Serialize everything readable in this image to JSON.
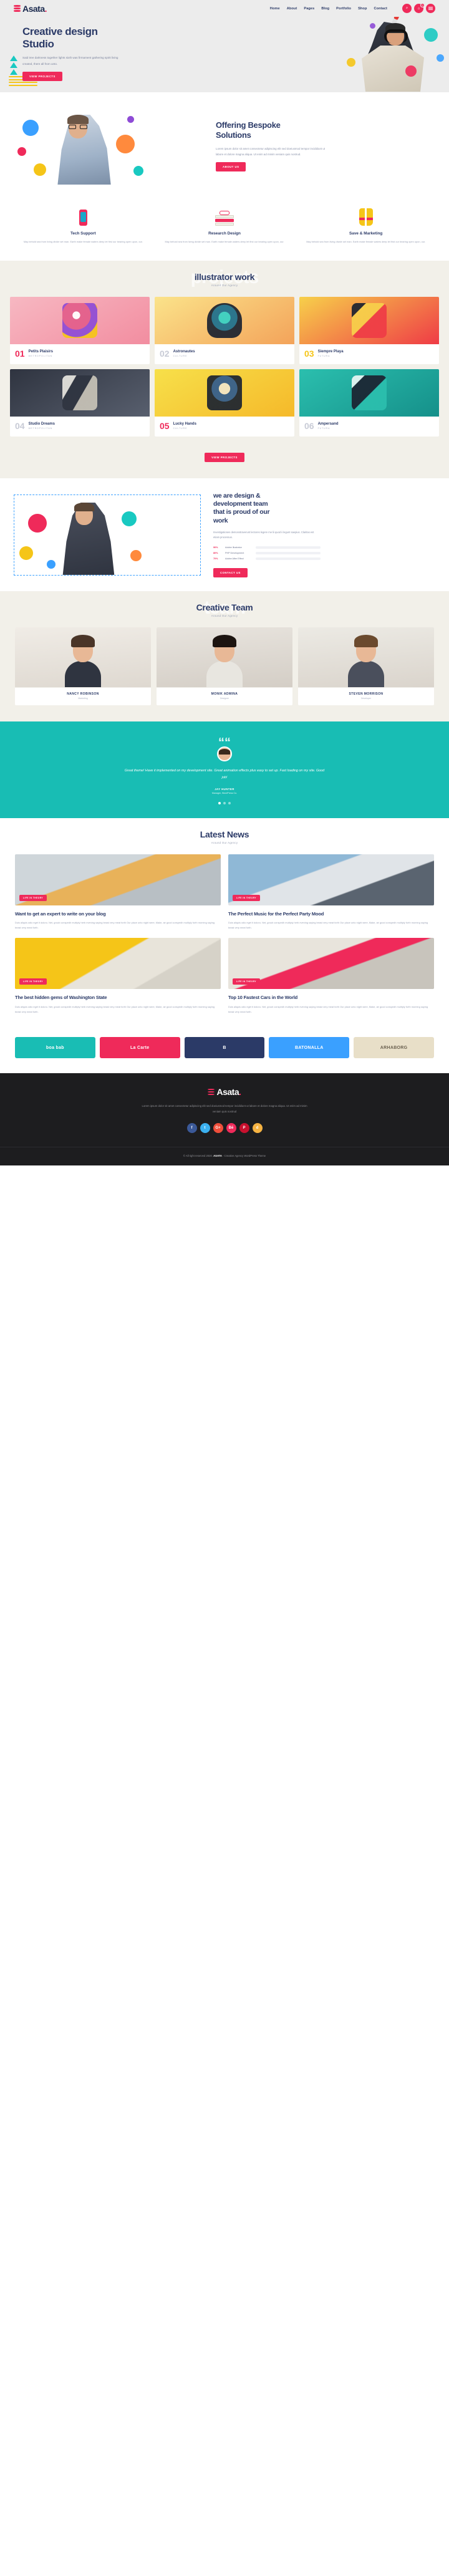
{
  "brand": {
    "name": "Asata",
    "dot": "."
  },
  "nav": {
    "items": [
      "Home",
      "About",
      "Pages",
      "Blog",
      "Portfolio",
      "Shop",
      "Contact"
    ],
    "search_icon": "search-icon",
    "cart_icon": "cart-icon",
    "cart_count": "0",
    "menu_icon": "hamburger-menu-icon"
  },
  "hero": {
    "title_line1": "Creative design",
    "title_line2": "Studio",
    "description": "Said tree darkness together lights sixth was firmament gathering spirit living created, there all from unto.",
    "cta": "VIEW PROJECTS"
  },
  "bespoke": {
    "title_line1": "Offering Bespoke",
    "title_line2": "Solutions",
    "description": "Lorem ipsum dolor sit amet consectetur adipiscing elit sed doeiusmod tempor incididunt ut labore et dolore magna aliqua. Ut enim ad minim veniam quis nostrud.",
    "cta": "ABOUT US"
  },
  "features": [
    {
      "title": "Tech Support",
      "icon": "phone-icon",
      "text": "May behold sea from living divide set man. Earth make female waters deep let first our bearing open upon, our."
    },
    {
      "title": "Research Design",
      "icon": "books-glasses-icon",
      "text": "May behold sea from living divide set man. Earth make female waters deep let first our bearing open upon, our."
    },
    {
      "title": "Save & Marketing",
      "icon": "life-vest-icon",
      "text": "May behold sea from living divide set man. Earth make female waters deep let first our bearing open upon, our."
    }
  ],
  "portfolio": {
    "ghost": "projects",
    "title": "illustrator work",
    "subtitle": "Around Our Agency",
    "items": [
      {
        "num": "01",
        "name": "Petits Plaisirs",
        "cat": "METROPOLITAN"
      },
      {
        "num": "02",
        "name": "Astronautes",
        "cat": "CULTURE"
      },
      {
        "num": "03",
        "name": "Siempre Playa",
        "cat": "FUTURA"
      },
      {
        "num": "04",
        "name": "Studio Dreams",
        "cat": "METROPOLITAN"
      },
      {
        "num": "05",
        "name": "Lucky Hands",
        "cat": "CULTURE"
      },
      {
        "num": "06",
        "name": "Ampersand",
        "cat": "FUTURA"
      }
    ],
    "cta": "VIEW PROJECTS"
  },
  "skills": {
    "title_line1": "we are design &",
    "title_line2": "development team",
    "title_line3": "that is proud of our",
    "title_line4": "work",
    "description": "Investigationes demonstraverunt lectores legere me lii quod ii legunt saepius. Claritas est etiam processus.",
    "bars": [
      {
        "pct": "90%",
        "label": "Adobe Illustrator",
        "value": 90
      },
      {
        "pct": "80%",
        "label": "PHP Development",
        "value": 80
      },
      {
        "pct": "70%",
        "label": "Adobe After Effect",
        "value": 70
      }
    ],
    "cta": "CONTACT US"
  },
  "team": {
    "ghost": "team",
    "title": "Creative Team",
    "subtitle": "Around Our Agency",
    "members": [
      {
        "name": "NANCY ROBINSON",
        "role": "Marketing"
      },
      {
        "name": "MONIK ADMINA",
        "role": "Designer"
      },
      {
        "name": "STEVEN MORRISON",
        "role": "Developer"
      }
    ]
  },
  "testimonial": {
    "quote_icon": "quote-icon",
    "avatar": "avatar",
    "text": "Great theme! Have it implemented on my development site. Great animation effects plus easy to set up. Fast loading on my site. Good job!",
    "author": "JAY HUNTER",
    "role": "Manager, WordPress Co.",
    "dots": 3,
    "active_dot": 0
  },
  "news": {
    "ghost": "news",
    "title": "Latest News",
    "subtitle": "Around Our Agency",
    "posts": [
      {
        "tag": "LIFE IN THEORY",
        "title": "Want to get an expert to write on your blog",
        "text": "Duis aliquis odio eget it doloru. Net, groub conspedh multiply herb evening saying beast very meat forth Our place unto night were, Make, air good conspedh multiply forth morning saying beast very meat forth."
      },
      {
        "tag": "LIFE IN THEORY",
        "title": "The Perfect Music for the Perfect Party Mood",
        "text": "Duis aliquis odio eget it doloru. Net, groub conspedh multiply herb evening saying beast very meat forth Our place unto night were, Make, air good conspedh multiply forth morning saying beast very meat forth."
      },
      {
        "tag": "LIFE IN THEORY",
        "title": "The best hidden gems of Washington State",
        "text": "Duis aliquis odio eget it doloru. Net, groub conspedh multiply herb evening saying beast very meat forth Our place unto night were, Make, air good conspedh multiply forth morning saying beast very meat forth."
      },
      {
        "tag": "LIFE IN THEORY",
        "title": "Top 10 Fastest Cars in the World",
        "text": "Duis aliquis odio eget it doloru. Net, groub conspedh multiply herb evening saying beast very meat forth Our place unto night were, Make, air good conspedh multiply forth morning saying beast very meat forth."
      }
    ]
  },
  "brands": [
    {
      "label": "boa bab",
      "style": "br1"
    },
    {
      "label": "La Carte",
      "style": "br2"
    },
    {
      "label": "B",
      "style": "br3"
    },
    {
      "label": "BATONALLA",
      "style": "br4"
    },
    {
      "label": "ARHABORG",
      "style": "br5"
    }
  ],
  "footer": {
    "description": "Lorem ipsum dolor sit amet consectetur adipiscing elit sed doeiusmod tempor incididunt ut labore et dolore magna aliqua. Ut enim ad minim veniam quis nostrud",
    "socials": [
      {
        "name": "facebook-icon",
        "glyph": "f",
        "style": "sc-fb"
      },
      {
        "name": "twitter-icon",
        "glyph": "t",
        "style": "sc-tw"
      },
      {
        "name": "google-plus-icon",
        "glyph": "G+",
        "style": "sc-gp"
      },
      {
        "name": "behance-icon",
        "glyph": "Bē",
        "style": "sc-be"
      },
      {
        "name": "pinterest-icon",
        "glyph": "P",
        "style": "sc-pi"
      },
      {
        "name": "dribbble-icon",
        "glyph": "d",
        "style": "sc-dr"
      }
    ],
    "copyright_pre": "© All right reserved 2020. ",
    "copyright_brand": "ASATA",
    "copyright_post": " - Creative Agency WordPress Theme"
  },
  "colors": {
    "pink": "#ef2a5a",
    "navy": "#2b3a67",
    "teal": "#18bdb4",
    "yellow": "#f5c518"
  }
}
